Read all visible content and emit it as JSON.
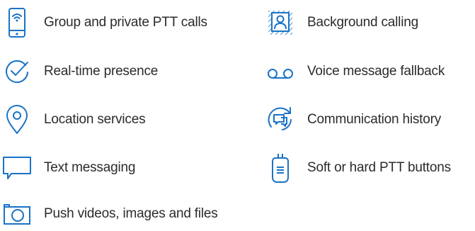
{
  "accent_color": "#1a73c6",
  "text_color": "#2b2b2b",
  "features": [
    {
      "label": "Group and private PTT calls",
      "icon": "smartphone-wifi-icon"
    },
    {
      "label": "Real-time presence",
      "icon": "check-circle-icon"
    },
    {
      "label": "Location services",
      "icon": "location-pin-icon"
    },
    {
      "label": "Text messaging",
      "icon": "chat-bubble-icon"
    },
    {
      "label": "Push videos, images and files",
      "icon": "camera-icon"
    },
    {
      "label": "Background calling",
      "icon": "contact-card-icon"
    },
    {
      "label": "Voice message fallback",
      "icon": "voicemail-icon"
    },
    {
      "label": "Communication history",
      "icon": "chat-history-icon"
    },
    {
      "label": "Soft or hard PTT buttons",
      "icon": "ptt-radio-icon"
    }
  ]
}
